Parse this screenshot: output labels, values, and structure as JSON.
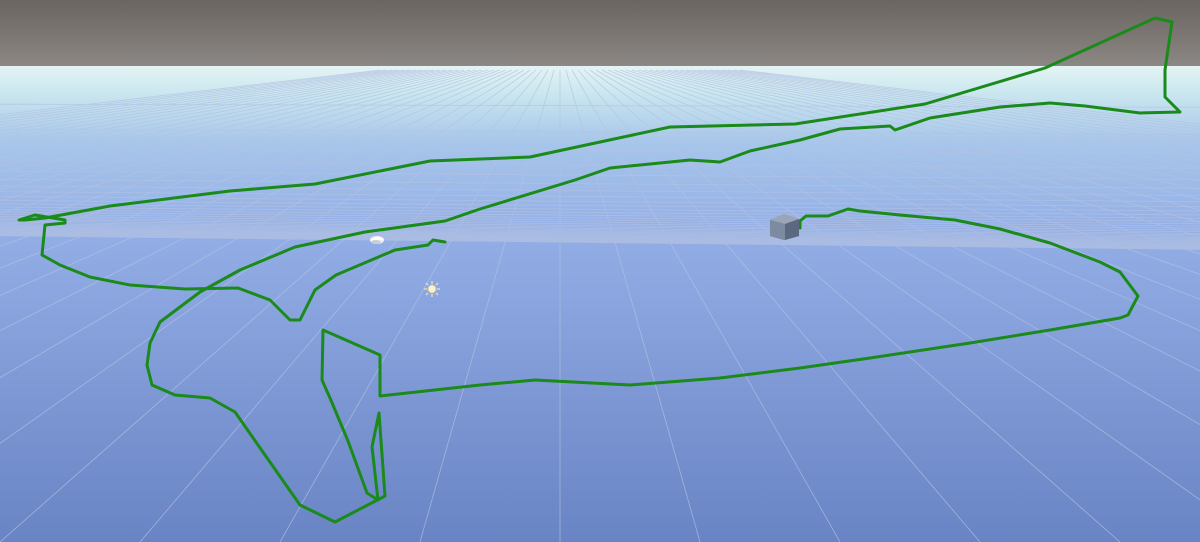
{
  "scene_view": {
    "colors": {
      "sky_dark": "#6b6562",
      "sky_horizon": "#d8eef2",
      "ground_near_horizon": "#9db4e4",
      "ground_far": "#6a85c5",
      "grid_line": "#a9b9db",
      "path_stroke": "#1a8a1a",
      "cube_face": "#7b8aa0"
    },
    "icons": {
      "camera_gizmo": "camera-icon",
      "light_gizmo": "sun-light-icon",
      "selected_object": "cube-icon"
    }
  }
}
